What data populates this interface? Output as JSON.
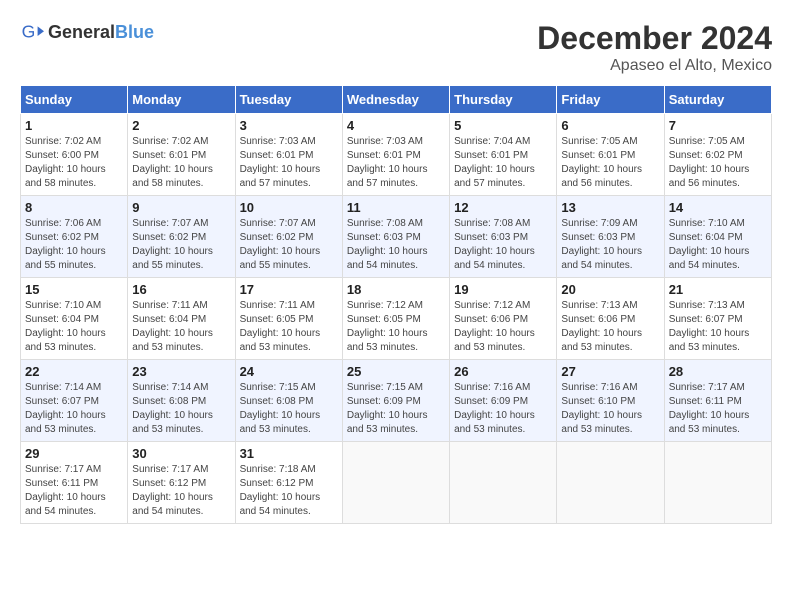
{
  "header": {
    "logo_general": "General",
    "logo_blue": "Blue",
    "month": "December 2024",
    "location": "Apaseo el Alto, Mexico"
  },
  "weekdays": [
    "Sunday",
    "Monday",
    "Tuesday",
    "Wednesday",
    "Thursday",
    "Friday",
    "Saturday"
  ],
  "weeks": [
    [
      {
        "day": "1",
        "sunrise": "7:02 AM",
        "sunset": "6:00 PM",
        "daylight": "10 hours and 58 minutes."
      },
      {
        "day": "2",
        "sunrise": "7:02 AM",
        "sunset": "6:01 PM",
        "daylight": "10 hours and 58 minutes."
      },
      {
        "day": "3",
        "sunrise": "7:03 AM",
        "sunset": "6:01 PM",
        "daylight": "10 hours and 57 minutes."
      },
      {
        "day": "4",
        "sunrise": "7:03 AM",
        "sunset": "6:01 PM",
        "daylight": "10 hours and 57 minutes."
      },
      {
        "day": "5",
        "sunrise": "7:04 AM",
        "sunset": "6:01 PM",
        "daylight": "10 hours and 57 minutes."
      },
      {
        "day": "6",
        "sunrise": "7:05 AM",
        "sunset": "6:01 PM",
        "daylight": "10 hours and 56 minutes."
      },
      {
        "day": "7",
        "sunrise": "7:05 AM",
        "sunset": "6:02 PM",
        "daylight": "10 hours and 56 minutes."
      }
    ],
    [
      {
        "day": "8",
        "sunrise": "7:06 AM",
        "sunset": "6:02 PM",
        "daylight": "10 hours and 55 minutes."
      },
      {
        "day": "9",
        "sunrise": "7:07 AM",
        "sunset": "6:02 PM",
        "daylight": "10 hours and 55 minutes."
      },
      {
        "day": "10",
        "sunrise": "7:07 AM",
        "sunset": "6:02 PM",
        "daylight": "10 hours and 55 minutes."
      },
      {
        "day": "11",
        "sunrise": "7:08 AM",
        "sunset": "6:03 PM",
        "daylight": "10 hours and 54 minutes."
      },
      {
        "day": "12",
        "sunrise": "7:08 AM",
        "sunset": "6:03 PM",
        "daylight": "10 hours and 54 minutes."
      },
      {
        "day": "13",
        "sunrise": "7:09 AM",
        "sunset": "6:03 PM",
        "daylight": "10 hours and 54 minutes."
      },
      {
        "day": "14",
        "sunrise": "7:10 AM",
        "sunset": "6:04 PM",
        "daylight": "10 hours and 54 minutes."
      }
    ],
    [
      {
        "day": "15",
        "sunrise": "7:10 AM",
        "sunset": "6:04 PM",
        "daylight": "10 hours and 53 minutes."
      },
      {
        "day": "16",
        "sunrise": "7:11 AM",
        "sunset": "6:04 PM",
        "daylight": "10 hours and 53 minutes."
      },
      {
        "day": "17",
        "sunrise": "7:11 AM",
        "sunset": "6:05 PM",
        "daylight": "10 hours and 53 minutes."
      },
      {
        "day": "18",
        "sunrise": "7:12 AM",
        "sunset": "6:05 PM",
        "daylight": "10 hours and 53 minutes."
      },
      {
        "day": "19",
        "sunrise": "7:12 AM",
        "sunset": "6:06 PM",
        "daylight": "10 hours and 53 minutes."
      },
      {
        "day": "20",
        "sunrise": "7:13 AM",
        "sunset": "6:06 PM",
        "daylight": "10 hours and 53 minutes."
      },
      {
        "day": "21",
        "sunrise": "7:13 AM",
        "sunset": "6:07 PM",
        "daylight": "10 hours and 53 minutes."
      }
    ],
    [
      {
        "day": "22",
        "sunrise": "7:14 AM",
        "sunset": "6:07 PM",
        "daylight": "10 hours and 53 minutes."
      },
      {
        "day": "23",
        "sunrise": "7:14 AM",
        "sunset": "6:08 PM",
        "daylight": "10 hours and 53 minutes."
      },
      {
        "day": "24",
        "sunrise": "7:15 AM",
        "sunset": "6:08 PM",
        "daylight": "10 hours and 53 minutes."
      },
      {
        "day": "25",
        "sunrise": "7:15 AM",
        "sunset": "6:09 PM",
        "daylight": "10 hours and 53 minutes."
      },
      {
        "day": "26",
        "sunrise": "7:16 AM",
        "sunset": "6:09 PM",
        "daylight": "10 hours and 53 minutes."
      },
      {
        "day": "27",
        "sunrise": "7:16 AM",
        "sunset": "6:10 PM",
        "daylight": "10 hours and 53 minutes."
      },
      {
        "day": "28",
        "sunrise": "7:17 AM",
        "sunset": "6:11 PM",
        "daylight": "10 hours and 53 minutes."
      }
    ],
    [
      {
        "day": "29",
        "sunrise": "7:17 AM",
        "sunset": "6:11 PM",
        "daylight": "10 hours and 54 minutes."
      },
      {
        "day": "30",
        "sunrise": "7:17 AM",
        "sunset": "6:12 PM",
        "daylight": "10 hours and 54 minutes."
      },
      {
        "day": "31",
        "sunrise": "7:18 AM",
        "sunset": "6:12 PM",
        "daylight": "10 hours and 54 minutes."
      },
      null,
      null,
      null,
      null
    ]
  ]
}
